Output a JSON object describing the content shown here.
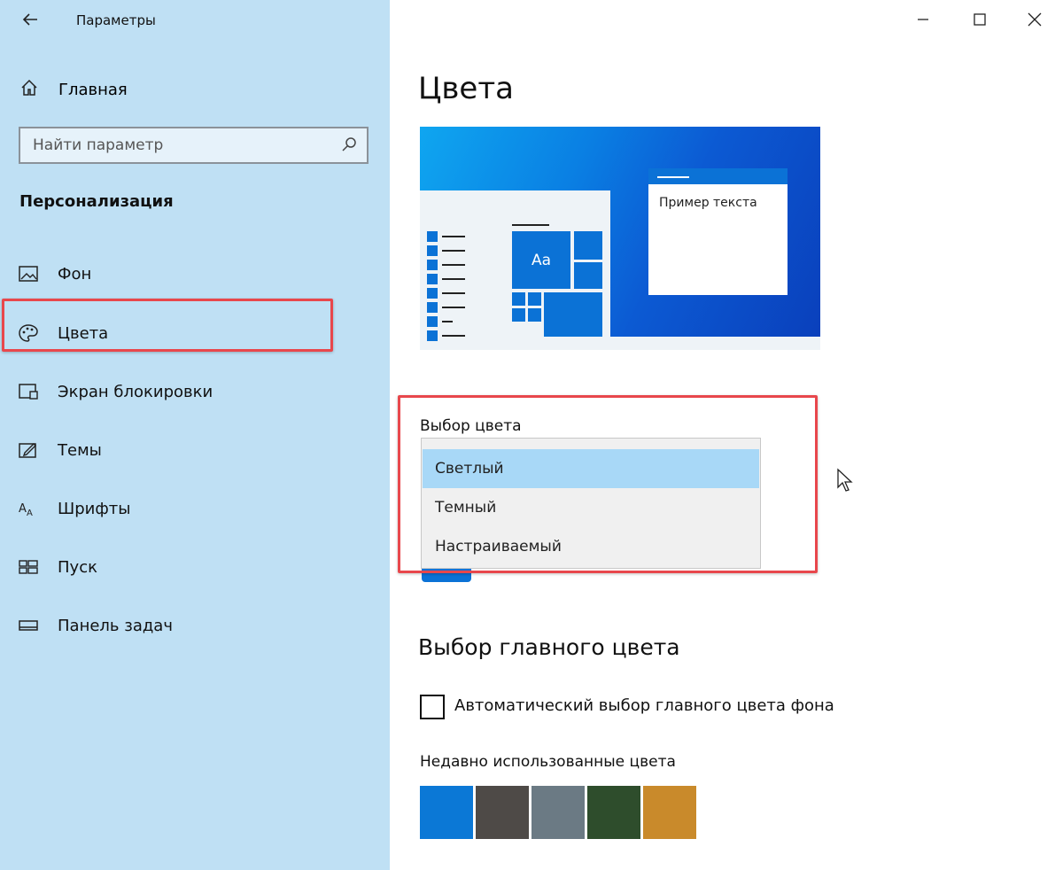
{
  "window": {
    "title": "Параметры",
    "back_icon": "back-arrow-icon",
    "controls": [
      "minimize-icon",
      "maximize-icon",
      "close-icon"
    ]
  },
  "sidebar": {
    "home": {
      "label": "Главная",
      "icon": "home-icon"
    },
    "search": {
      "placeholder": "Найти параметр",
      "value": "",
      "icon": "search-icon"
    },
    "section_title": "Персонализация",
    "items": [
      {
        "label": "Фон",
        "icon": "picture-icon",
        "selected": false
      },
      {
        "label": "Цвета",
        "icon": "palette-icon",
        "selected": true
      },
      {
        "label": "Экран блокировки",
        "icon": "lock-screen-icon",
        "selected": false
      },
      {
        "label": "Темы",
        "icon": "themes-icon",
        "selected": false
      },
      {
        "label": "Шрифты",
        "icon": "fonts-icon",
        "selected": false
      },
      {
        "label": "Пуск",
        "icon": "start-icon",
        "selected": false
      },
      {
        "label": "Панель задач",
        "icon": "taskbar-icon",
        "selected": false
      }
    ]
  },
  "main": {
    "title": "Цвета",
    "preview": {
      "tile_label": "Aa",
      "window_text": "Пример текста"
    },
    "color_choice": {
      "label": "Выбор цвета",
      "options": [
        "Светлый",
        "Темный",
        "Настраиваемый"
      ],
      "selected": "Светлый"
    },
    "accent": {
      "title": "Выбор главного цвета",
      "auto_checkbox_label": "Автоматический выбор главного цвета фона",
      "auto_checked": false,
      "recent_label": "Недавно использованные цвета",
      "recent_colors": [
        "#0b78d6",
        "#4e4a47",
        "#6b7a84",
        "#2e4d2c",
        "#c98a2b"
      ]
    }
  },
  "colors": {
    "sidebar_bg": "#bfe0f4",
    "accent": "#0b72d6",
    "highlight": "#e8474c",
    "selected_option": "#a8d8f7"
  }
}
